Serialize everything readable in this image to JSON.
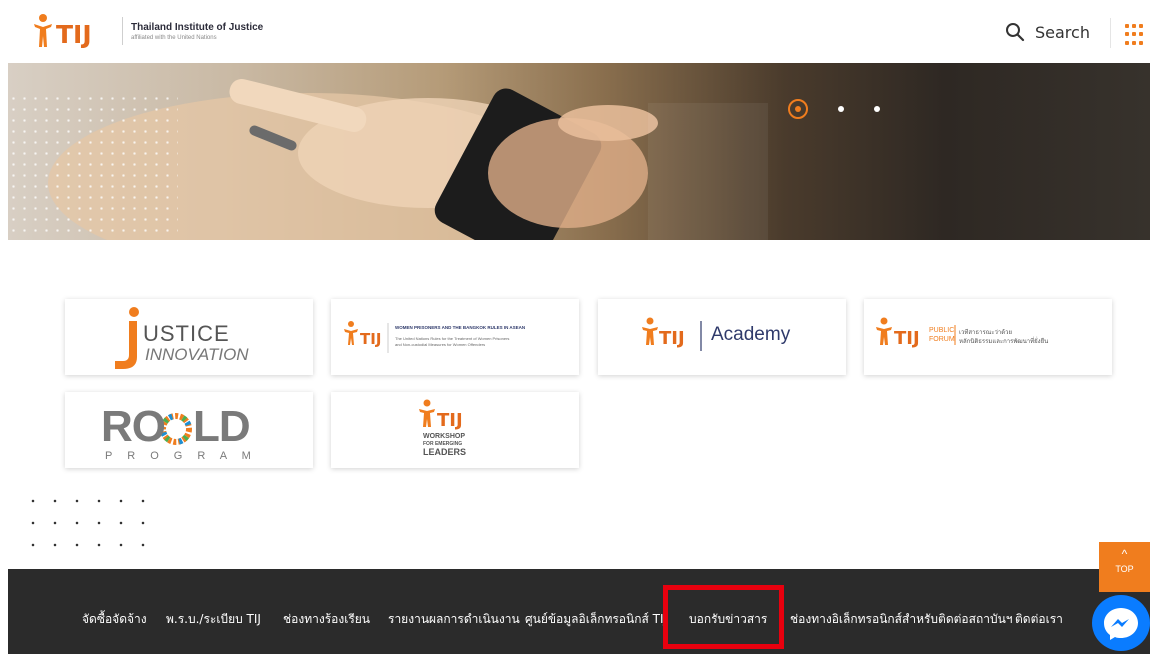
{
  "header": {
    "org_name": "Thailand Institute of Justice",
    "org_sub": "affiliated with the United Nations",
    "search_label": "Search",
    "logo_icon": "tij-logo",
    "search_icon": "search-icon",
    "apps_icon": "grid-apps-icon"
  },
  "hero": {
    "carousel": {
      "slides": 3,
      "active_index": 0
    }
  },
  "partners": [
    {
      "name": "justice-innovation",
      "line1": "USTICE",
      "line2": "INNOVATION"
    },
    {
      "name": "bangkok-rules",
      "line1": "WOMEN PRISONERS AND THE BANGKOK RULES IN ASEAN",
      "line2": "The United Nations Rules for the Treatment of Women Prisoners",
      "line3": "and Non-custodial Measures for Women Offenders"
    },
    {
      "name": "tij-academy",
      "line1": "Academy"
    },
    {
      "name": "tij-public-forum",
      "line1": "PUBLIC",
      "line2": "FORUM",
      "line3": "เวทีสาธารณะว่าด้วย",
      "line4": "หลักนิติธรรมและการพัฒนาที่ยั่งยืน"
    },
    {
      "name": "rold-program",
      "line1": "RO",
      "line2": "LD",
      "line3": "P R O G R A M"
    },
    {
      "name": "workshop-emerging-leaders",
      "line1": "WORKSHOP",
      "line2": "FOR EMERGING",
      "line3": "LEADERS"
    }
  ],
  "footer": {
    "nav": [
      "จัดซื้อจัดจ้าง",
      "พ.ร.บ./ระเบียบ TIJ",
      "ช่องทางร้องเรียน",
      "รายงานผลการดำเนินงาน",
      "ศูนย์ข้อมูลอิเล็กทรอนิกส์ TIJ",
      "บอกรับข่าวสาร",
      "ช่องทางอิเล็กทรอนิกส์สำหรับติดต่อสถาบันฯ",
      "ติดต่อเรา"
    ],
    "highlighted_index": 5
  },
  "floating": {
    "top_label": "TOP",
    "top_icon": "chevron-up-icon",
    "messenger_icon": "messenger-icon"
  },
  "colors": {
    "accent": "#f07d1e",
    "footer_bg": "#2b2b2b",
    "highlight": "#e8000e",
    "messenger": "#0a7cff",
    "academy_blue": "#2f3a6b"
  }
}
